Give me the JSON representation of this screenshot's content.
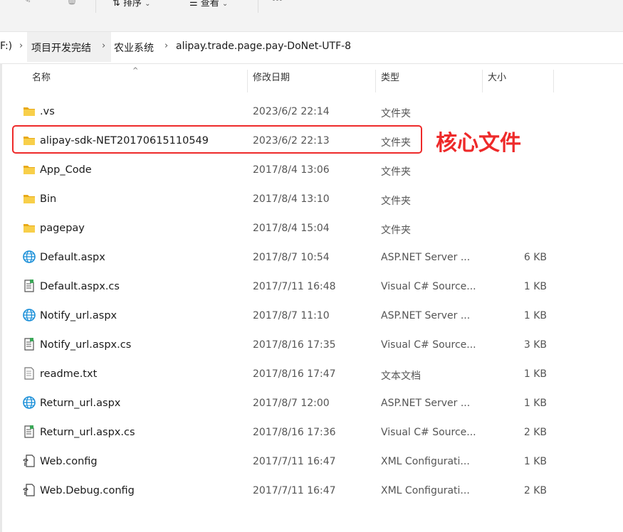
{
  "toolbar": {
    "sort_label": "排序",
    "view_label": "查看",
    "more_label": "···"
  },
  "breadcrumb": {
    "drive": "F:)",
    "seg1": "项目开发完结",
    "seg2": "农业系统",
    "seg3": "alipay.trade.page.pay-DoNet-UTF-8"
  },
  "columns": {
    "name": "名称",
    "date": "修改日期",
    "type": "类型",
    "size": "大小"
  },
  "files": [
    {
      "name": ".vs",
      "date": "2023/6/2 22:14",
      "type": "文件夹",
      "size": "",
      "icon": "folder-icon"
    },
    {
      "name": "alipay-sdk-NET20170615110549",
      "date": "2023/6/2 22:13",
      "type": "文件夹",
      "size": "",
      "icon": "folder-icon"
    },
    {
      "name": "App_Code",
      "date": "2017/8/4 13:06",
      "type": "文件夹",
      "size": "",
      "icon": "folder-icon"
    },
    {
      "name": "Bin",
      "date": "2017/8/4 13:10",
      "type": "文件夹",
      "size": "",
      "icon": "folder-icon"
    },
    {
      "name": "pagepay",
      "date": "2017/8/4 15:04",
      "type": "文件夹",
      "size": "",
      "icon": "folder-icon"
    },
    {
      "name": "Default.aspx",
      "date": "2017/8/7 10:54",
      "type": "ASP.NET Server ...",
      "size": "6 KB",
      "icon": "web-page-icon"
    },
    {
      "name": "Default.aspx.cs",
      "date": "2017/7/11 16:48",
      "type": "Visual C# Source...",
      "size": "1 KB",
      "icon": "csharp-file-icon"
    },
    {
      "name": "Notify_url.aspx",
      "date": "2017/8/7 11:10",
      "type": "ASP.NET Server ...",
      "size": "1 KB",
      "icon": "web-page-icon"
    },
    {
      "name": "Notify_url.aspx.cs",
      "date": "2017/8/16 17:35",
      "type": "Visual C# Source...",
      "size": "3 KB",
      "icon": "csharp-file-icon"
    },
    {
      "name": "readme.txt",
      "date": "2017/8/16 17:47",
      "type": "文本文档",
      "size": "1 KB",
      "icon": "text-file-icon"
    },
    {
      "name": "Return_url.aspx",
      "date": "2017/8/7 12:00",
      "type": "ASP.NET Server ...",
      "size": "1 KB",
      "icon": "web-page-icon"
    },
    {
      "name": "Return_url.aspx.cs",
      "date": "2017/8/16 17:36",
      "type": "Visual C# Source...",
      "size": "2 KB",
      "icon": "csharp-file-icon"
    },
    {
      "name": "Web.config",
      "date": "2017/7/11 16:47",
      "type": "XML Configurati...",
      "size": "1 KB",
      "icon": "config-file-icon"
    },
    {
      "name": "Web.Debug.config",
      "date": "2017/7/11 16:47",
      "type": "XML Configurati...",
      "size": "2 KB",
      "icon": "config-file-icon"
    }
  ],
  "annotation": {
    "text": "核心文件",
    "color": "#ee2a2a"
  },
  "colors": {
    "folder": "#f4c542",
    "web_icon": "#1a8fd8",
    "accent_red": "#ee2a2a"
  }
}
